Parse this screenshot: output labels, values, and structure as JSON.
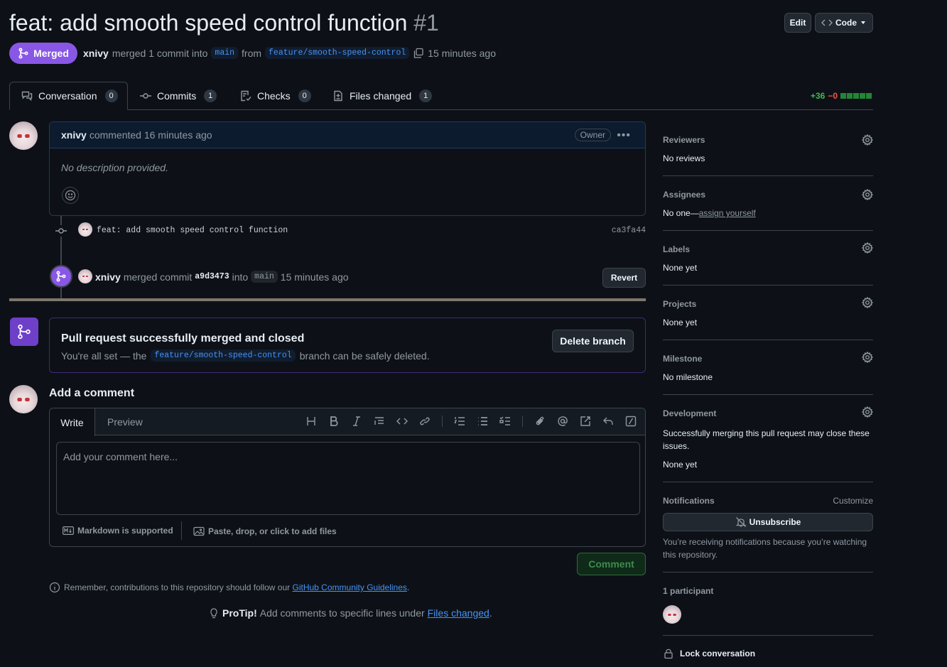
{
  "pr": {
    "title": "feat: add smooth speed control function",
    "number": "#1",
    "state": "Merged",
    "author": "xnivy",
    "summary_mid": "merged 1 commit into",
    "base_branch": "main",
    "from_word": "from",
    "head_branch": "feature/smooth-speed-control",
    "time": "15 minutes ago"
  },
  "header_buttons": {
    "edit": "Edit",
    "code": "Code"
  },
  "tabs": [
    {
      "label": "Conversation",
      "count": "0"
    },
    {
      "label": "Commits",
      "count": "1"
    },
    {
      "label": "Checks",
      "count": "0"
    },
    {
      "label": "Files changed",
      "count": "1"
    }
  ],
  "diffstat": {
    "additions": "+36",
    "deletions": "−0"
  },
  "comment": {
    "author": "xnivy",
    "action": "commented 16 minutes ago",
    "badge": "Owner",
    "body": "No description provided."
  },
  "commit": {
    "message": "feat: add smooth speed control function",
    "sha": "ca3fa44"
  },
  "merge_event": {
    "author": "xnivy",
    "text1": "merged commit",
    "sha": "a9d3473",
    "text2": "into",
    "branch": "main",
    "time": "15 minutes ago",
    "revert": "Revert"
  },
  "merged_box": {
    "title": "Pull request successfully merged and closed",
    "text_before": "You're all set — the",
    "branch": "feature/smooth-speed-control",
    "text_after": "branch can be safely deleted.",
    "delete_button": "Delete branch"
  },
  "add_comment": {
    "heading": "Add a comment",
    "tab_write": "Write",
    "tab_preview": "Preview",
    "placeholder": "Add your comment here...",
    "markdown": "Markdown is supported",
    "attach": "Paste, drop, or click to add files",
    "submit": "Comment"
  },
  "guidelines": {
    "text": "Remember, contributions to this repository should follow our",
    "link": "GitHub Community Guidelines",
    "end": "."
  },
  "protip": {
    "label": "ProTip!",
    "text": "Add comments to specific lines under",
    "link": "Files changed",
    "end": "."
  },
  "sidebar": {
    "reviewers": {
      "title": "Reviewers",
      "value": "No reviews"
    },
    "assignees": {
      "title": "Assignees",
      "value": "No one—",
      "link": "assign yourself"
    },
    "labels": {
      "title": "Labels",
      "value": "None yet"
    },
    "projects": {
      "title": "Projects",
      "value": "None yet"
    },
    "milestone": {
      "title": "Milestone",
      "value": "No milestone"
    },
    "development": {
      "title": "Development",
      "desc": "Successfully merging this pull request may close these issues.",
      "value": "None yet"
    },
    "notifications": {
      "title": "Notifications",
      "customize": "Customize",
      "button": "Unsubscribe",
      "desc": "You’re receiving notifications because you’re watching this repository."
    },
    "participants": {
      "title": "1 participant"
    },
    "lock": "Lock conversation"
  },
  "colors": {
    "merged": "#8957e5",
    "add": "#3fb950",
    "del": "#f85149",
    "link": "#4493f8"
  }
}
